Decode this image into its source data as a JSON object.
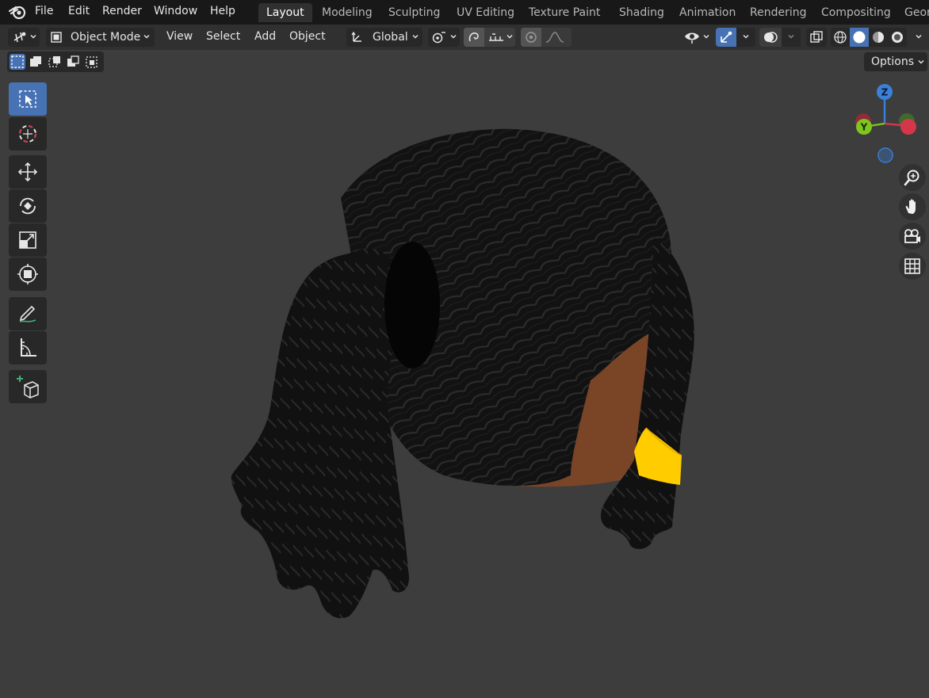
{
  "menubar": {
    "items": [
      "File",
      "Edit",
      "Render",
      "Window",
      "Help"
    ]
  },
  "workspaces": {
    "tabs": [
      "Layout",
      "Modeling",
      "Sculpting",
      "UV Editing",
      "Texture Paint",
      "Shading",
      "Animation",
      "Rendering",
      "Compositing",
      "Geor"
    ],
    "active": "Layout"
  },
  "header": {
    "mode_label": "Object Mode",
    "menus": [
      "View",
      "Select",
      "Add",
      "Object"
    ],
    "orientation_label": "Global"
  },
  "options_label": "Options",
  "gizmo": {
    "z_label": "Z",
    "y_label": "Y"
  },
  "colors": {
    "accent": "#4772b3",
    "x_axis": "#d4364a",
    "y_axis": "#7ec61f",
    "z_axis": "#3b80d9",
    "hair_band": "#ffcc00",
    "skin": "#7a4527"
  },
  "icons": [
    "blender-logo-icon",
    "editor-type-icon",
    "object-mode-icon",
    "transform-orientation-icon",
    "pivot-point-icon",
    "snap-icon",
    "snap-increment-icon",
    "proportional-edit-icon",
    "falloff-icon",
    "visibility-icon",
    "gizmo-icon",
    "overlays-icon",
    "xray-icon",
    "wireframe-shading-icon",
    "solid-shading-icon",
    "material-preview-icon",
    "rendered-shading-icon",
    "select-box-icon",
    "cursor-icon",
    "move-icon",
    "rotate-icon",
    "scale-icon",
    "transform-icon",
    "annotate-icon",
    "measure-icon",
    "add-cube-icon",
    "zoom-icon",
    "pan-hand-icon",
    "camera-view-icon",
    "ortho-grid-icon"
  ]
}
